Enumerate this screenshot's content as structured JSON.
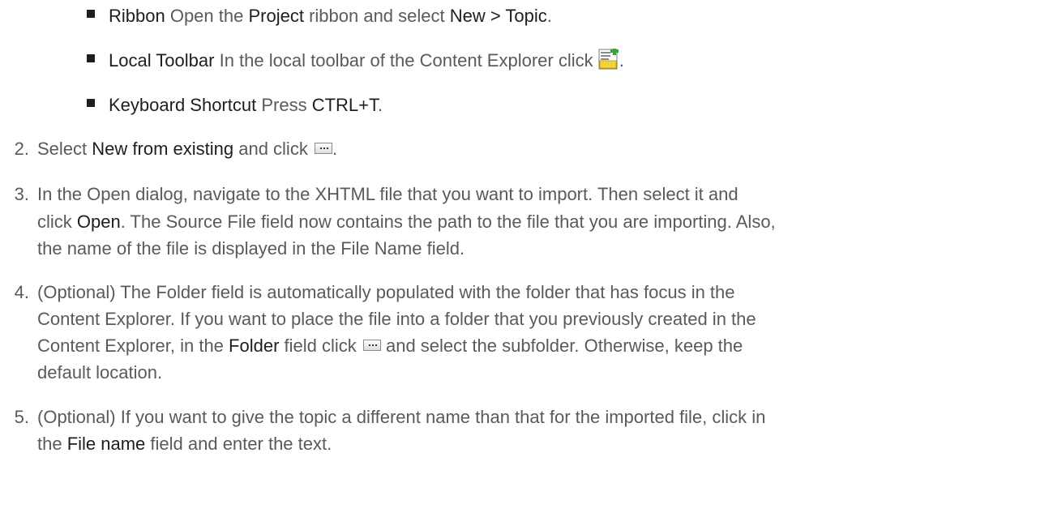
{
  "bullets": [
    {
      "term": "Ribbon",
      "t1": " Open the ",
      "b1": "Project",
      "t2": " ribbon and select ",
      "b2": "New > Topic",
      "t3": "."
    },
    {
      "term": "Local Toolbar",
      "text": " In the local toolbar of the Content Explorer click ",
      "icon": "new-topic-icon",
      "end": "."
    },
    {
      "term": "Keyboard Shortcut",
      "text": " Press ",
      "key": "CTRL+T",
      "end": "."
    }
  ],
  "steps": [
    {
      "num": "2.",
      "t1": "Select ",
      "b1": "New from existing",
      "t2": " and click ",
      "icon": "browse-ellipsis-icon",
      "end": "."
    },
    {
      "num": "3.",
      "l1": "In the Open dialog, navigate to the XHTML file that you want to import. Then select it and",
      "l2a": "click ",
      "l2b": "Open",
      "l2c": ". The Source File field now contains the path to the file that you are importing. Also,",
      "l3": "the name of the file is displayed in the File Name field."
    },
    {
      "num": "4.",
      "l1": "(Optional) The Folder field is automatically populated with the folder that has focus in the",
      "l2": "Content Explorer. If you want to place the file into a folder that you previously created in the",
      "l3a": "Content Explorer, in the ",
      "l3b": "Folder",
      "l3c": " field click ",
      "icon": "browse-ellipsis-icon",
      "l3d": " and select the subfolder. Otherwise, keep the",
      "l4": "default location."
    },
    {
      "num": "5.",
      "l1": "(Optional) If you want to give the topic a different name than that for the imported file, click in",
      "l2a": "the ",
      "l2b": "File name",
      "l2c": " field and enter the text."
    }
  ]
}
